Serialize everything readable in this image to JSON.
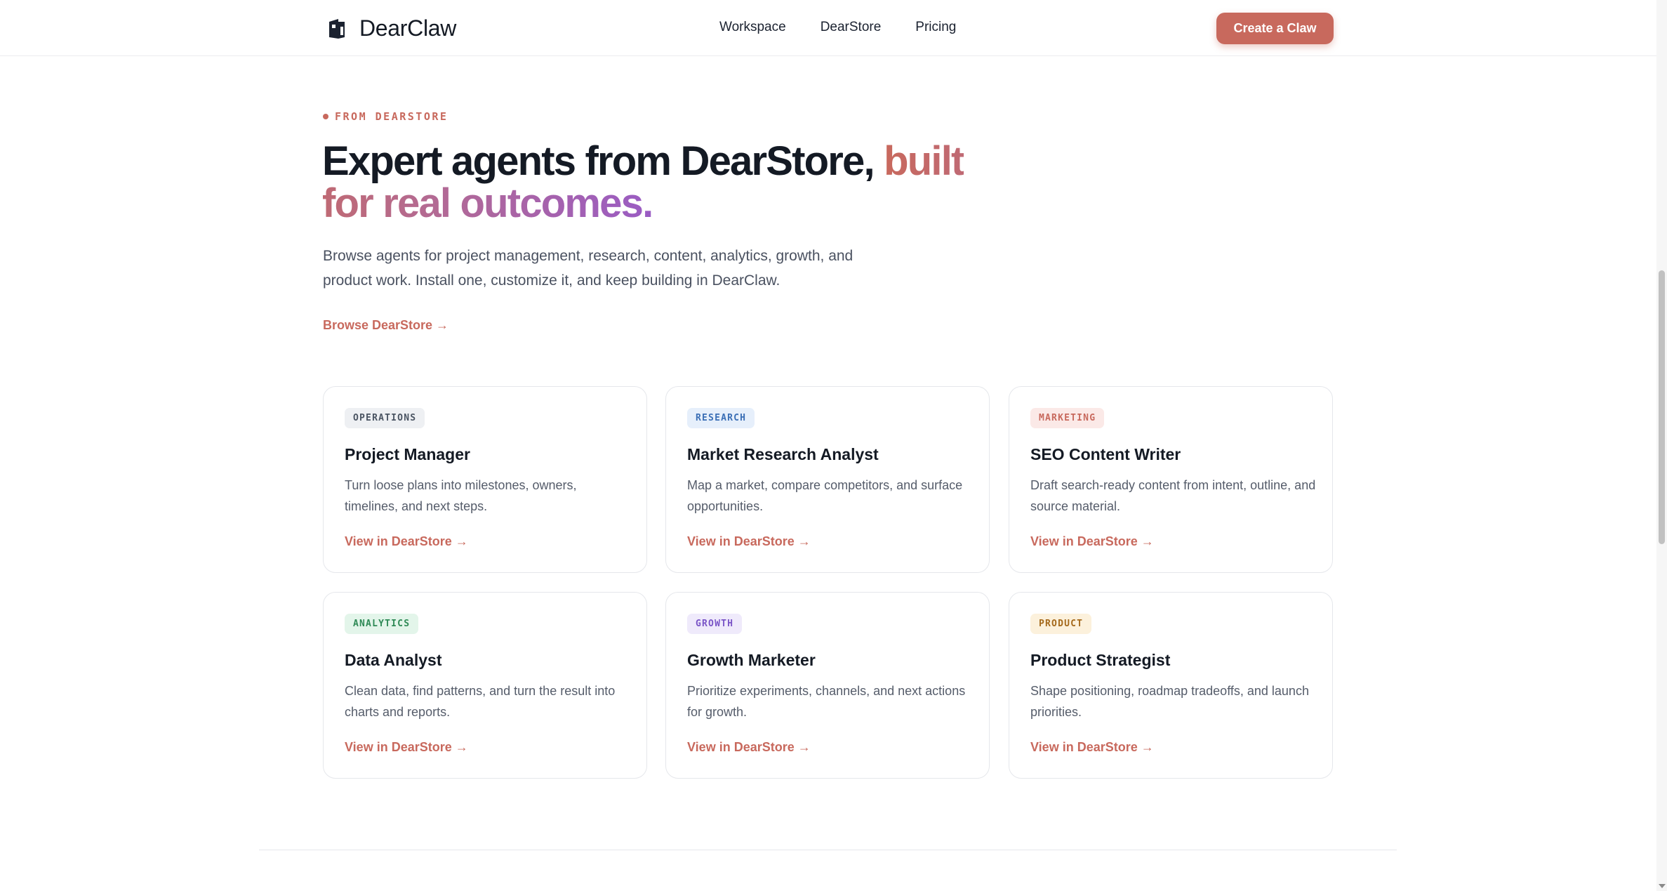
{
  "header": {
    "brand": "DearClaw",
    "nav": [
      "Workspace",
      "DearStore",
      "Pricing"
    ],
    "cta": "Create a Claw"
  },
  "hero": {
    "eyebrow": "FROM DEARSTORE",
    "headline_plain": "Expert agents from DearStore, ",
    "headline_accent": "built for real outcomes.",
    "subtitle": "Browse agents for project management, research, content, analytics, growth, and product work. Install one, customize it, and keep building in DearClaw.",
    "browse_link": "Browse DearStore  →"
  },
  "cards": [
    {
      "badge": "OPERATIONS",
      "badge_bg": "#eef0f3",
      "badge_fg": "#4b5563",
      "title": "Project Manager",
      "desc": "Turn loose plans into milestones, owners, timelines, and next steps.",
      "link": "View in DearStore  →"
    },
    {
      "badge": "RESEARCH",
      "badge_bg": "#e6effb",
      "badge_fg": "#3b6fb6",
      "title": "Market Research Analyst",
      "desc": "Map a market, compare competitors, and surface opportunities.",
      "link": "View in DearStore  →"
    },
    {
      "badge": "MARKETING",
      "badge_bg": "#fbe9e7",
      "badge_fg": "#c8695d",
      "title": "SEO Content Writer",
      "desc": "Draft search-ready content from intent, outline, and source material.",
      "link": "View in DearStore  →"
    },
    {
      "badge": "ANALYTICS",
      "badge_bg": "#e3f5ea",
      "badge_fg": "#2f8a56",
      "title": "Data Analyst",
      "desc": "Clean data, find patterns, and turn the result into charts and reports.",
      "link": "View in DearStore  →"
    },
    {
      "badge": "GROWTH",
      "badge_bg": "#efeafb",
      "badge_fg": "#7a55c7",
      "title": "Growth Marketer",
      "desc": "Prioritize experiments, channels, and next actions for growth.",
      "link": "View in DearStore  →"
    },
    {
      "badge": "PRODUCT",
      "badge_bg": "#fcf1dc",
      "badge_fg": "#a56a1c",
      "title": "Product Strategist",
      "desc": "Shape positioning, roadmap tradeoffs, and launch priorities.",
      "link": "View in DearStore  →"
    }
  ],
  "colors": {
    "accent": "#c8695d",
    "text": "#141a24",
    "muted": "#555c6a"
  }
}
